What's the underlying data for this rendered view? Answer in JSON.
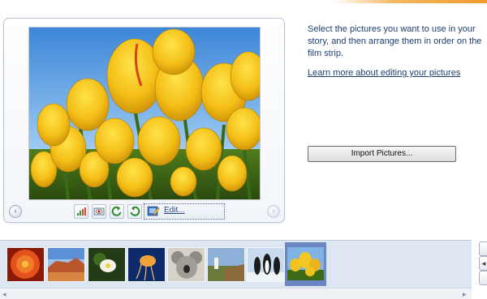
{
  "instructions": "Select the pictures you want to use in your story, and then arrange them in order on the film strip.",
  "learn_link": "Learn more about editing your pictures",
  "import_button": "Import Pictures...",
  "toolbar": {
    "edit_label": "Edit..."
  },
  "nav": {
    "prev_glyph": "‹",
    "next_glyph": "›"
  },
  "scroll": {
    "left_glyph": "◂",
    "right_glyph": "▸"
  },
  "side_buttons": [
    "",
    "◂",
    ""
  ],
  "filmstrip": {
    "thumbnails": [
      {
        "name": "red-flower",
        "selected": false
      },
      {
        "name": "desert",
        "selected": false
      },
      {
        "name": "white-flower",
        "selected": false
      },
      {
        "name": "jellyfish",
        "selected": false
      },
      {
        "name": "koala",
        "selected": false
      },
      {
        "name": "lighthouse",
        "selected": false
      },
      {
        "name": "penguins",
        "selected": false
      },
      {
        "name": "tulips",
        "selected": true
      }
    ]
  },
  "colors": {
    "link": "#1e3f72",
    "selection": "#6b86c5",
    "filmstrip_bg": "#dde6f1",
    "accent": "#f19a2d"
  }
}
